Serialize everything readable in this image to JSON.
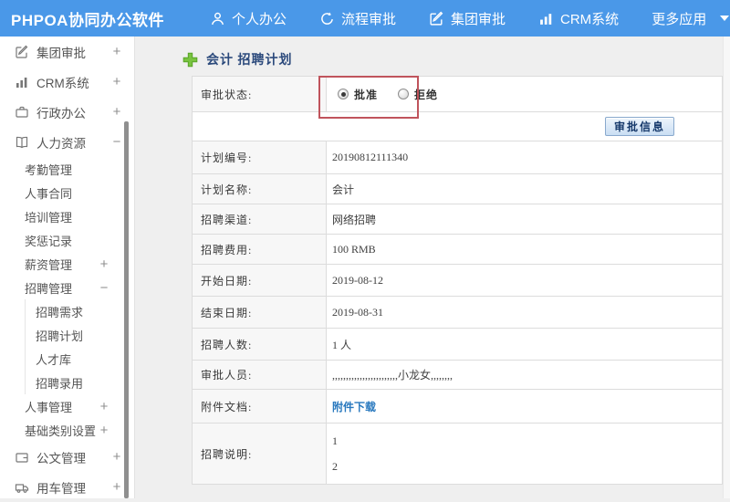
{
  "colors": {
    "navbar_blue": "#4a98e8",
    "annotation_red": "#c0545c",
    "link_blue": "#2878be",
    "title_blue": "#2c4a7c"
  },
  "navbar": {
    "logo": "PHPOA协同办公软件",
    "items": [
      {
        "icon": "user-icon",
        "label": "个人办公"
      },
      {
        "icon": "cycle-icon",
        "label": "流程审批"
      },
      {
        "icon": "edit-icon",
        "label": "集团审批"
      },
      {
        "icon": "chart-icon",
        "label": "CRM系统"
      },
      {
        "icon": "caret-down-icon",
        "label": "更多应用"
      }
    ]
  },
  "sidebar": {
    "items": [
      {
        "label": "集团审批",
        "icon": "edit-icon",
        "expander": "+",
        "level": 0
      },
      {
        "label": "CRM系统",
        "icon": "chart-icon",
        "expander": "+",
        "level": 0
      },
      {
        "label": "行政办公",
        "icon": "briefcase-icon",
        "expander": "+",
        "level": 0
      },
      {
        "label": "人力资源",
        "icon": "book-icon",
        "expander": "−",
        "level": 0
      },
      {
        "label": "考勤管理",
        "level": 1
      },
      {
        "label": "人事合同",
        "level": 1
      },
      {
        "label": "培训管理",
        "level": 1
      },
      {
        "label": "奖惩记录",
        "level": 1
      },
      {
        "label": "薪资管理",
        "expander": "+",
        "level": 1
      },
      {
        "label": "招聘管理",
        "expander": "−",
        "level": 1
      },
      {
        "label": "招聘需求",
        "level": 2
      },
      {
        "label": "招聘计划",
        "level": 2
      },
      {
        "label": "人才库",
        "level": 2
      },
      {
        "label": "招聘录用",
        "level": 2
      },
      {
        "label": "人事管理",
        "expander": "+",
        "level": 1
      },
      {
        "label": "基础类别设置",
        "expander": "+",
        "level": 1
      },
      {
        "label": "公文管理",
        "icon": "wallet-icon",
        "expander": "+",
        "level": 0
      },
      {
        "label": "用车管理",
        "icon": "truck-icon",
        "expander": "+",
        "level": 0
      }
    ]
  },
  "main": {
    "title": "会计 招聘计划",
    "approval": {
      "label": "审批状态:",
      "options": [
        {
          "label": "批准",
          "selected": true
        },
        {
          "label": "拒绝",
          "selected": false
        }
      ],
      "info_button": "审批信息"
    },
    "fields": [
      {
        "label": "计划编号:",
        "value": "20190812111340"
      },
      {
        "label": "计划名称:",
        "value": "会计"
      },
      {
        "label": "招聘渠道:",
        "value": "网络招聘"
      },
      {
        "label": "招聘费用:",
        "value": "100 RMB"
      },
      {
        "label": "开始日期:",
        "value": "2019-08-12"
      },
      {
        "label": "结束日期:",
        "value": "2019-08-31"
      },
      {
        "label": "招聘人数:",
        "value": "1 人"
      },
      {
        "label": "审批人员:",
        "value": ",,,,,,,,,,,,,,,,,,,,,,,,小龙女,,,,,,,,"
      },
      {
        "label": "附件文档:",
        "value": "附件下载"
      }
    ],
    "description": {
      "label": "招聘说明:",
      "lines": [
        "1",
        "2"
      ]
    }
  }
}
